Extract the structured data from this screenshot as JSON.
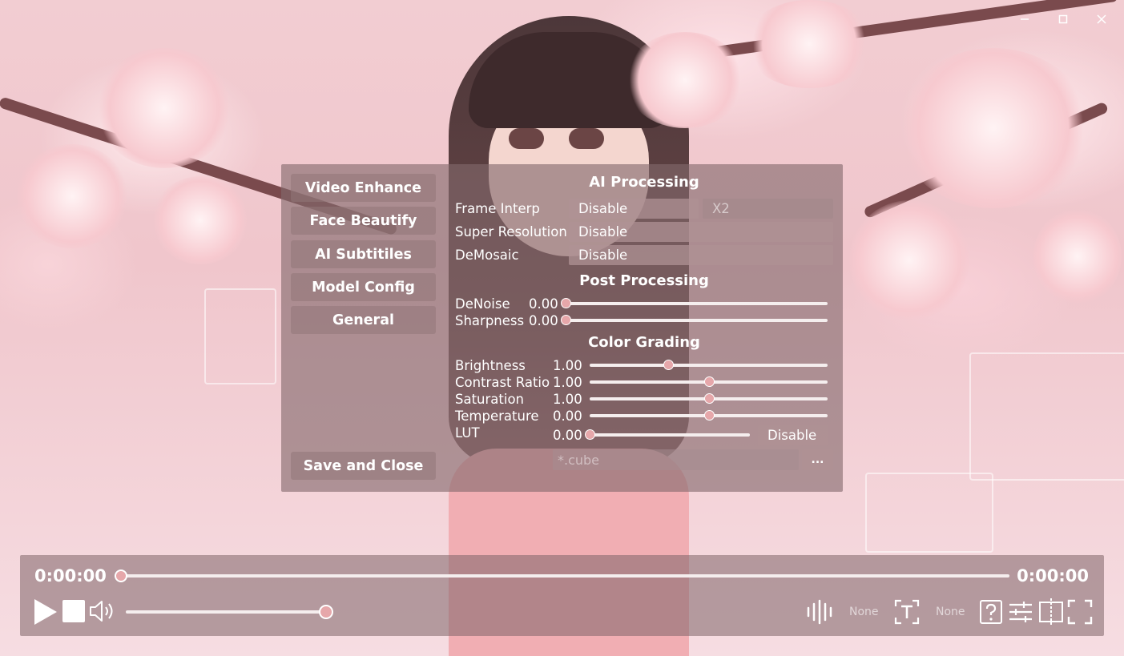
{
  "window": {
    "controls": {
      "minimize": "—",
      "maximize": "☐",
      "close": "✕"
    }
  },
  "settings": {
    "nav": {
      "video_enhance": "Video Enhance",
      "face_beautify": "Face Beautify",
      "ai_subtitles": "AI Subtitiles",
      "model_config": "Model Config",
      "general": "General",
      "save_and_close": "Save and Close"
    },
    "ai_processing": {
      "title": "AI Processing",
      "frame_interp": {
        "label": "Frame Interp",
        "value": "Disable",
        "secondary": "X2"
      },
      "super_resolution": {
        "label": "Super Resolution",
        "value": "Disable"
      },
      "demosaic": {
        "label": "DeMosaic",
        "value": "Disable"
      }
    },
    "post_processing": {
      "title": "Post Processing",
      "denoise": {
        "label": "DeNoise",
        "value": "0.00",
        "level": 0.0
      },
      "sharpness": {
        "label": "Sharpness",
        "value": "0.00",
        "level": 0.0
      }
    },
    "color_grading": {
      "title": "Color Grading",
      "brightness": {
        "label": "Brightness",
        "value": "1.00",
        "level": 0.33
      },
      "contrast": {
        "label": "Contrast Ratio",
        "value": "1.00",
        "level": 0.5
      },
      "saturation": {
        "label": "Saturation",
        "value": "1.00",
        "level": 0.5
      },
      "temperature": {
        "label": "Temperature",
        "value": "0.00",
        "level": 0.5
      },
      "lut": {
        "label": "LUT",
        "value": "0.00",
        "level": 0.0,
        "toggle": "Disable",
        "file_placeholder": "*.cube",
        "browse": "..."
      }
    }
  },
  "player": {
    "current_time": "0:00:00",
    "total_time": "0:00:00",
    "progress": 0.0,
    "volume": 1.0,
    "audio_track": "None",
    "subtitle_track": "None",
    "icons": [
      "play-icon",
      "stop-icon",
      "volume-icon",
      "audio-track-icon",
      "subtitle-icon",
      "help-icon",
      "settings-sliders-icon",
      "compare-icon",
      "fullscreen-icon"
    ]
  },
  "colors": {
    "accent": "#e6a7aa",
    "panel": "#82696c",
    "track": "#f5eeee"
  }
}
